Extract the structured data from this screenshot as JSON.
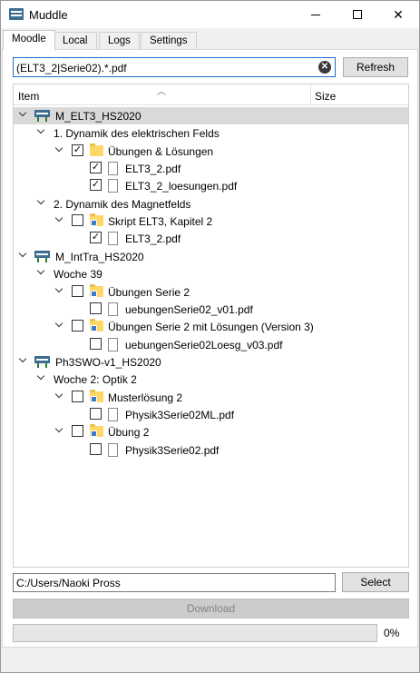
{
  "window": {
    "title": "Muddle"
  },
  "tabs": [
    {
      "label": "Moodle",
      "active": true
    },
    {
      "label": "Local",
      "active": false
    },
    {
      "label": "Logs",
      "active": false
    },
    {
      "label": "Settings",
      "active": false
    }
  ],
  "search": {
    "value": "(ELT3_2|Serie02).*.pdf"
  },
  "buttons": {
    "refresh": "Refresh",
    "select": "Select",
    "download": "Download"
  },
  "tree": {
    "columns": {
      "item": "Item",
      "size": "Size"
    },
    "rows": [
      {
        "label": "M_ELT3_HS2020",
        "type": "course",
        "level": 0,
        "expanded": true,
        "checked": null,
        "selected": true
      },
      {
        "label": "1. Dynamik des elektrischen Felds",
        "type": "section",
        "level": 1,
        "expanded": true,
        "checked": null
      },
      {
        "label": "Übungen & Lösungen",
        "type": "folder",
        "level": 2,
        "expanded": true,
        "checked": true
      },
      {
        "label": "ELT3_2.pdf",
        "type": "file",
        "level": 3,
        "checked": true
      },
      {
        "label": "ELT3_2_loesungen.pdf",
        "type": "file",
        "level": 3,
        "checked": true
      },
      {
        "label": "2. Dynamik des Magnetfelds",
        "type": "section",
        "level": 1,
        "expanded": true,
        "checked": null
      },
      {
        "label": "Skript ELT3, Kapitel 2",
        "type": "folder-link",
        "level": 2,
        "expanded": true,
        "checked": false
      },
      {
        "label": "ELT3_2.pdf",
        "type": "file",
        "level": 3,
        "checked": true
      },
      {
        "label": "M_IntTra_HS2020",
        "type": "course",
        "level": 0,
        "expanded": true,
        "checked": null
      },
      {
        "label": "Woche 39",
        "type": "section",
        "level": 1,
        "expanded": true,
        "checked": null
      },
      {
        "label": "Übungen Serie 2",
        "type": "folder-link",
        "level": 2,
        "expanded": true,
        "checked": false
      },
      {
        "label": "uebungenSerie02_v01.pdf",
        "type": "file",
        "level": 3,
        "checked": false
      },
      {
        "label": "Übungen Serie 2 mit Lösungen (Version 3)",
        "type": "folder-link",
        "level": 2,
        "expanded": true,
        "checked": false
      },
      {
        "label": "uebungenSerie02Loesg_v03.pdf",
        "type": "file",
        "level": 3,
        "checked": false
      },
      {
        "label": "Ph3SWO-v1_HS2020",
        "type": "course",
        "level": 0,
        "expanded": true,
        "checked": null
      },
      {
        "label": "Woche 2: Optik 2",
        "type": "section",
        "level": 1,
        "expanded": true,
        "checked": null
      },
      {
        "label": "Musterlösung 2",
        "type": "folder-link",
        "level": 2,
        "expanded": true,
        "checked": false
      },
      {
        "label": "Physik3Serie02ML.pdf",
        "type": "file",
        "level": 3,
        "checked": false
      },
      {
        "label": "Übung 2",
        "type": "folder-link",
        "level": 2,
        "expanded": true,
        "checked": false
      },
      {
        "label": "Physik3Serie02.pdf",
        "type": "file",
        "level": 3,
        "checked": false
      }
    ]
  },
  "path": {
    "value": "C:/Users/Naoki Pross"
  },
  "progress": {
    "percent_label": "0%",
    "value": 0
  }
}
